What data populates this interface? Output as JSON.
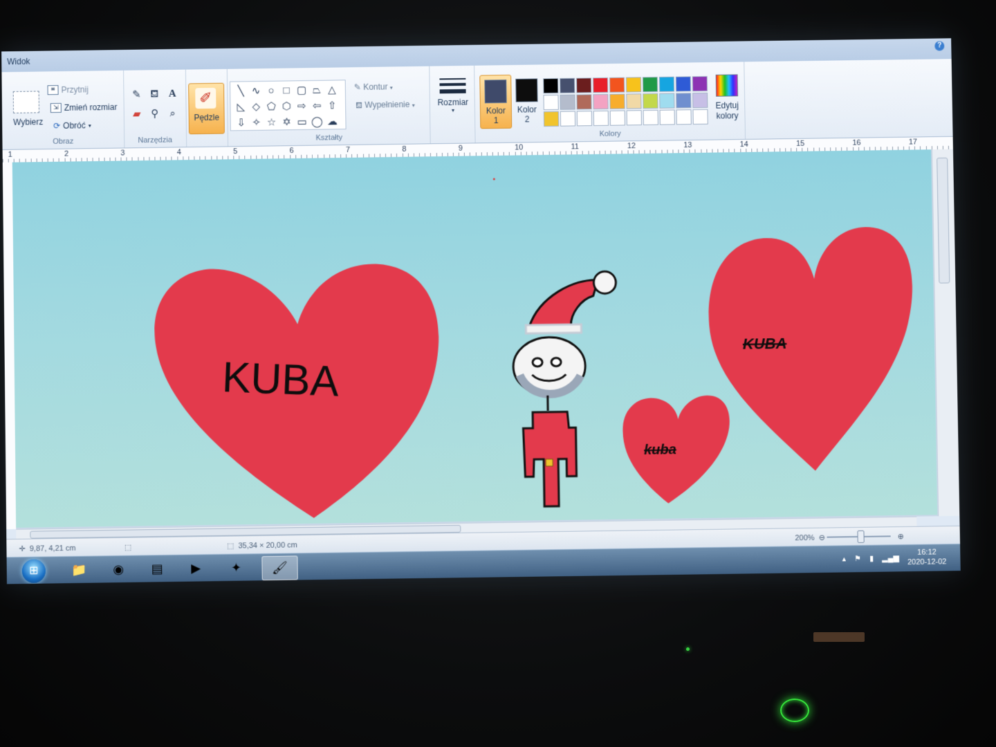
{
  "window": {
    "controls": [
      "–",
      "❐",
      "✕"
    ],
    "view_tab": "Widok",
    "help": "?"
  },
  "ribbon": {
    "image_group": {
      "label": "Obraz",
      "select": "Wybierz",
      "crop": "Przytnij",
      "resize": "Zmień rozmiar",
      "rotate": "Obróć"
    },
    "tools_group": {
      "label": "Narzędzia"
    },
    "brushes": "Pędzle",
    "shapes_group": {
      "label": "Kształty",
      "outline": "Kontur",
      "fill": "Wypełnienie"
    },
    "size": "Rozmiar",
    "color1": {
      "label": "Kolor",
      "sub": "1",
      "swatch": "#3f4a6a"
    },
    "color2": {
      "label": "Kolor",
      "sub": "2",
      "swatch": "#0d0d0d"
    },
    "colors_group": {
      "label": "Kolory"
    },
    "palette": [
      "#000000",
      "#46506e",
      "#6b1e1e",
      "#e81f2a",
      "#f2541e",
      "#f7c21c",
      "#1f9a47",
      "#16a5e0",
      "#2e5bd6",
      "#8d33b3",
      "#ffffff",
      "#b4bccc",
      "#b06a5a",
      "#f3a2c2",
      "#f7ad2c",
      "#f1d9a6",
      "#c3d84a",
      "#9fdcef",
      "#6f8fcf",
      "#c7bfe6",
      "#f1c42c",
      "#ffffff",
      "#ffffff",
      "#ffffff",
      "#ffffff",
      "#ffffff",
      "#ffffff",
      "#ffffff",
      "#ffffff",
      "#ffffff"
    ],
    "edit_colors": [
      "Edytuj",
      "kolory"
    ]
  },
  "ruler": [
    "1",
    "2",
    "3",
    "4",
    "5",
    "6",
    "7",
    "8",
    "9",
    "10",
    "11",
    "12",
    "13",
    "14",
    "15",
    "16",
    "17"
  ],
  "drawing": {
    "heart_left_text": "KUBA",
    "heart_small_text": "kuba",
    "heart_right_text": "KUBA",
    "heart_color": "#e33a4c",
    "sky_color": "#9fd7e0"
  },
  "status": {
    "cursor_pos": "9,87, 4,21 cm",
    "image_size": "35,34 × 20,00 cm",
    "zoom": "200%"
  },
  "taskbar": {
    "clock_time": "16:12",
    "clock_date": "2020-12-02"
  }
}
